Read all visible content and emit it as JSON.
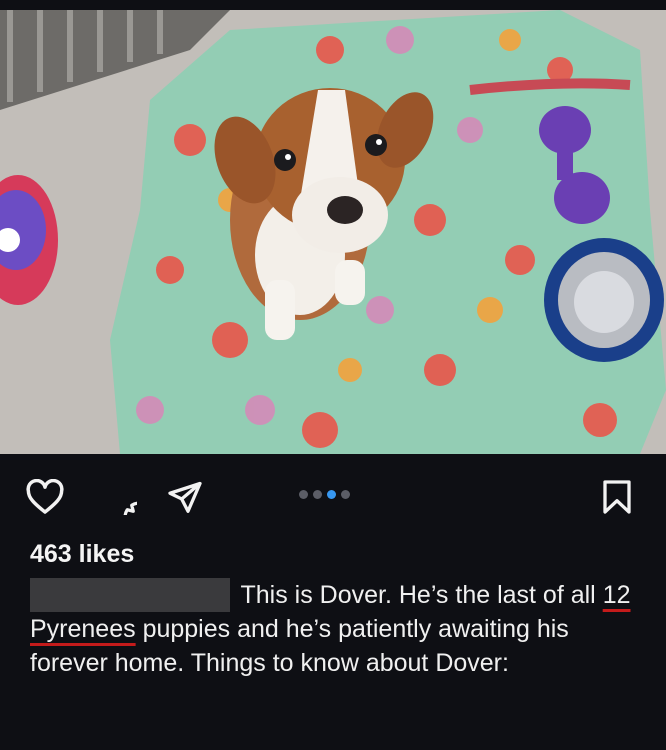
{
  "post": {
    "image_alt": "puppy sitting on blanket",
    "carousel": {
      "count": 4,
      "active_index": 2
    },
    "likes": "463 likes",
    "caption": {
      "username": "",
      "part1": " This is Dover. He’s the last of all ",
      "highlight": "12 Pyrenees",
      "part2": " puppies and he’s patiently awaiting his forever home. Things to know about Dover:"
    }
  },
  "icons": {
    "like": "heart-icon",
    "comment": "comment-icon",
    "share": "send-icon",
    "save": "bookmark-icon"
  },
  "colors": {
    "background": "#0e0f14",
    "text": "#f2f2f2",
    "accent_dot": "#3797f0",
    "underline": "#c41b1b"
  }
}
